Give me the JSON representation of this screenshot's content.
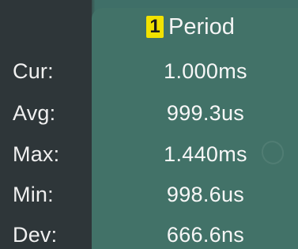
{
  "header": {
    "channel": "1",
    "measurement": "Period"
  },
  "rows": [
    {
      "label": "Cur:",
      "value": "1.000ms"
    },
    {
      "label": "Avg:",
      "value": "999.3us"
    },
    {
      "label": "Max:",
      "value": "1.440ms"
    },
    {
      "label": "Min:",
      "value": "998.6us"
    },
    {
      "label": "Dev:",
      "value": "666.6ns"
    }
  ],
  "colors": {
    "panel": "#427268",
    "label_column": "#2e3639",
    "channel_badge": "#f2e200"
  }
}
